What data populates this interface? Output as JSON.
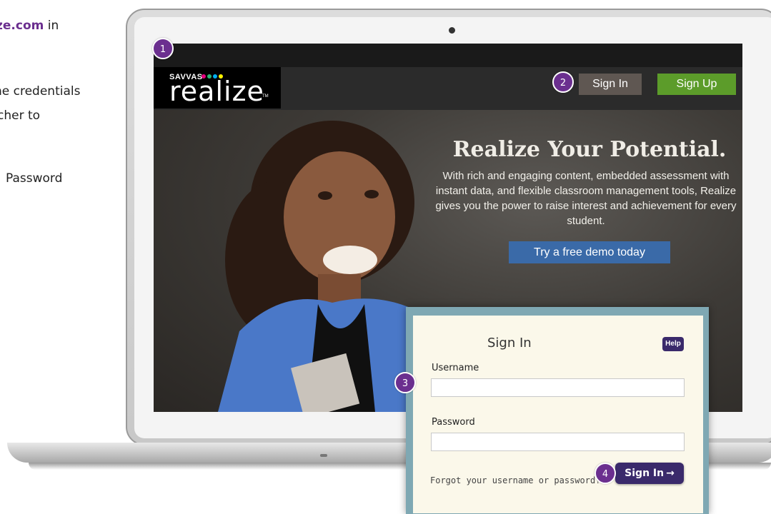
{
  "instructions": {
    "line1_bold": "ze.com",
    "line1_rest": " in",
    "line2": "he credentials",
    "line3": "cher to",
    "line4": "Password"
  },
  "site": {
    "logo_top": "SAVVAS",
    "logo_main": "realize",
    "logo_tm": "TM",
    "signin_label": "Sign In",
    "signup_label": "Sign Up",
    "hero_title": "Realize Your Potential.",
    "hero_text": "With rich and engaging content, embedded assessment with instant data, and flexible classroom management tools, Realize gives you the power to raise interest and achievement for every student.",
    "demo_label": "Try a free demo today"
  },
  "signin_dialog": {
    "title": "Sign In",
    "help_label": "Help",
    "username_label": "Username",
    "username_value": "",
    "password_label": "Password",
    "password_value": "",
    "forgot_link": "Forgot your username or password?",
    "submit_label": "Sign In",
    "submit_arrow": "→"
  },
  "steps": [
    "1",
    "2",
    "3",
    "4"
  ],
  "colors": {
    "step_badge": "#6b2f8f",
    "signup_green": "#5c9c2a",
    "demo_blue": "#3a6aa8",
    "dialog_button": "#3a2a6b"
  },
  "icons": [
    "arrow-right-icon",
    "camera-icon"
  ]
}
